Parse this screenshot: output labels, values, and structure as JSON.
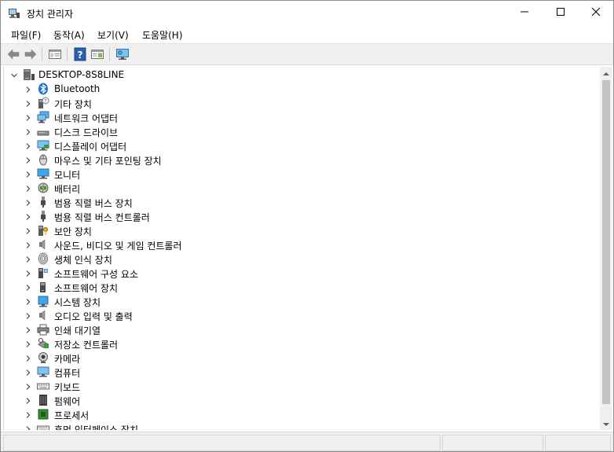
{
  "window": {
    "title": "장치 관리자",
    "icons": {
      "app": "device-manager-icon",
      "minimize": "minimize-icon",
      "maximize": "maximize-icon",
      "close": "close-icon"
    }
  },
  "menu": {
    "items": [
      {
        "label": "파일(F)"
      },
      {
        "label": "동작(A)"
      },
      {
        "label": "보기(V)"
      },
      {
        "label": "도움말(H)"
      }
    ]
  },
  "toolbar": {
    "buttons": [
      "back-arrow-icon",
      "forward-arrow-icon",
      "properties-pane-icon",
      "help-icon",
      "show-hide-pane-icon",
      "monitor-scan-icon"
    ]
  },
  "tree": {
    "root": {
      "label": "DESKTOP-8S8LINE",
      "icon": "computer-icon",
      "expanded": true
    },
    "items": [
      {
        "label": "Bluetooth",
        "icon": "bluetooth-icon"
      },
      {
        "label": "기타 장치",
        "icon": "unknown-device-icon"
      },
      {
        "label": "네트워크 어댑터",
        "icon": "network-adapter-icon"
      },
      {
        "label": "디스크 드라이브",
        "icon": "disk-drive-icon"
      },
      {
        "label": "디스플레이 어댑터",
        "icon": "display-adapter-icon"
      },
      {
        "label": "마우스 및 기타 포인팅 장치",
        "icon": "mouse-icon"
      },
      {
        "label": "모니터",
        "icon": "monitor-icon"
      },
      {
        "label": "배터리",
        "icon": "battery-icon"
      },
      {
        "label": "범용 직렬 버스 장치",
        "icon": "usb-device-icon"
      },
      {
        "label": "범용 직렬 버스 컨트롤러",
        "icon": "usb-controller-icon"
      },
      {
        "label": "보안 장치",
        "icon": "security-device-icon"
      },
      {
        "label": "사운드, 비디오 및 게임 컨트롤러",
        "icon": "sound-icon"
      },
      {
        "label": "생체 인식 장치",
        "icon": "fingerprint-icon"
      },
      {
        "label": "소프트웨어 구성 요소",
        "icon": "software-component-icon"
      },
      {
        "label": "소프트웨어 장치",
        "icon": "software-device-icon"
      },
      {
        "label": "시스템 장치",
        "icon": "system-device-icon"
      },
      {
        "label": "오디오 입력 및 출력",
        "icon": "audio-io-icon"
      },
      {
        "label": "인쇄 대기열",
        "icon": "printer-icon"
      },
      {
        "label": "저장소 컨트롤러",
        "icon": "storage-controller-icon"
      },
      {
        "label": "카메라",
        "icon": "camera-icon"
      },
      {
        "label": "컴퓨터",
        "icon": "computer-monitor-icon"
      },
      {
        "label": "키보드",
        "icon": "keyboard-icon"
      },
      {
        "label": "펌웨어",
        "icon": "firmware-icon"
      },
      {
        "label": "프로세서",
        "icon": "processor-icon"
      },
      {
        "label": "휴먼 인터페이스 장치",
        "icon": "hid-icon"
      }
    ]
  },
  "colors": {
    "window_bg": "#ffffff",
    "toolbar_bg": "#f0f0f0",
    "border": "#d9d9d9",
    "scroll_thumb": "#c2c2c2"
  }
}
